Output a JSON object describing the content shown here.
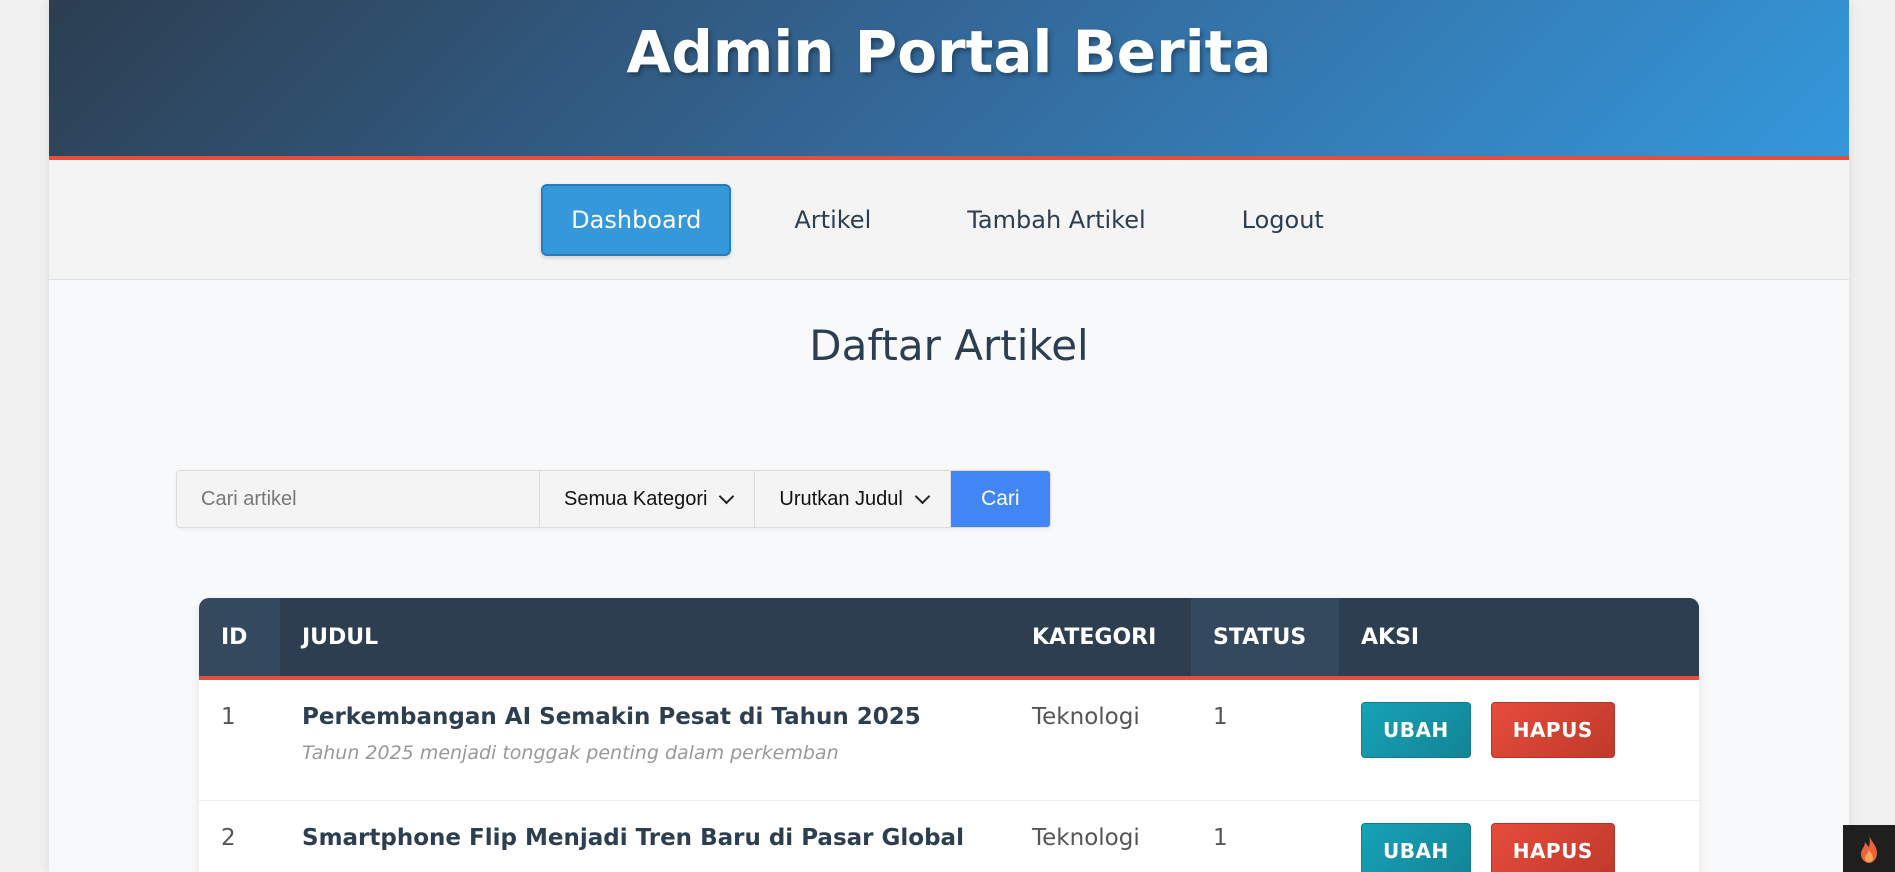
{
  "header": {
    "title": "Admin Portal Berita"
  },
  "nav": {
    "items": [
      {
        "label": "Dashboard",
        "active": true
      },
      {
        "label": "Artikel",
        "active": false
      },
      {
        "label": "Tambah Artikel",
        "active": false
      },
      {
        "label": "Logout",
        "active": false
      }
    ]
  },
  "main": {
    "title": "Daftar Artikel"
  },
  "search": {
    "placeholder": "Cari artikel",
    "category_selected": "Semua Kategori",
    "sort_selected": "Urutkan Judul",
    "button_label": "Cari"
  },
  "table": {
    "headers": [
      "ID",
      "JUDUL",
      "KATEGORI",
      "STATUS",
      "AKSI"
    ],
    "rows": [
      {
        "id": "1",
        "title": "Perkembangan AI Semakin Pesat di Tahun 2025",
        "excerpt": "Tahun 2025 menjadi tonggak penting dalam perkemban",
        "category": "Teknologi",
        "status": "1",
        "edit_label": "UBAH",
        "delete_label": "HAPUS"
      },
      {
        "id": "2",
        "title": "Smartphone Flip Menjadi Tren Baru di Pasar Global",
        "excerpt": "",
        "category": "Teknologi",
        "status": "1",
        "edit_label": "UBAH",
        "delete_label": "HAPUS"
      }
    ]
  },
  "colors": {
    "header_gradient_start": "#2c3e50",
    "header_gradient_end": "#3498db",
    "accent_red": "#e74c3c",
    "primary_blue": "#3498db",
    "search_button": "#4285f4",
    "edit_button": "#17a2b8",
    "delete_button": "#e74c3c"
  },
  "floating_icon": {
    "name": "flame-icon"
  }
}
